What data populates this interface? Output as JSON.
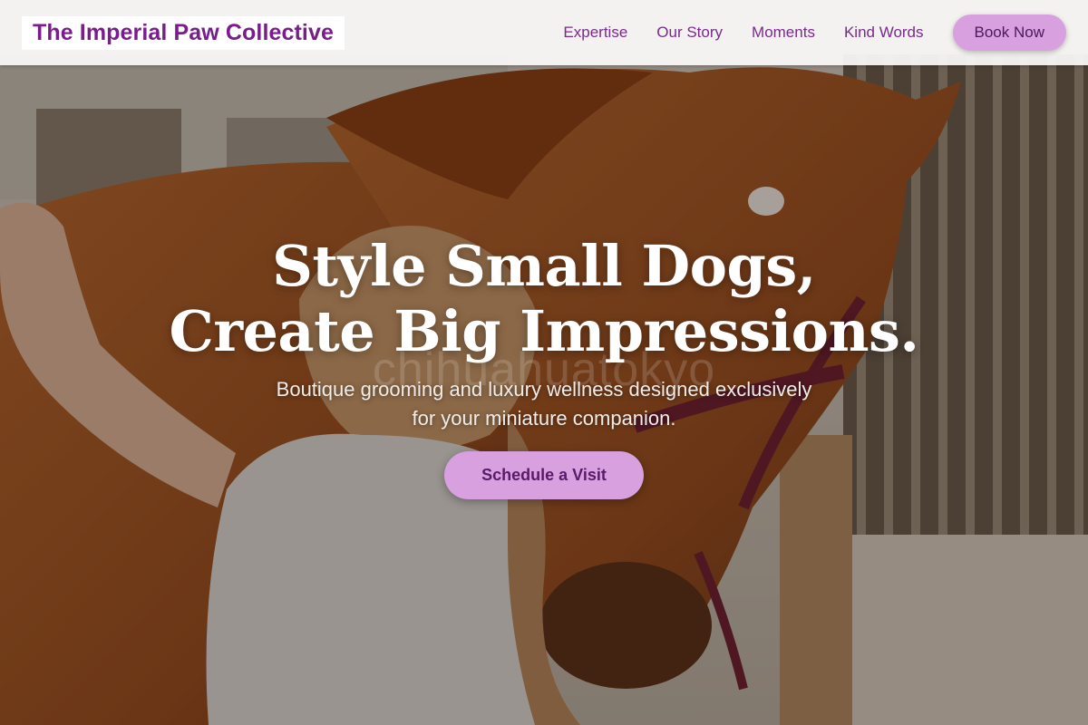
{
  "header": {
    "brand": "The Imperial Paw Collective",
    "nav": [
      "Expertise",
      "Our Story",
      "Moments",
      "Kind Words"
    ],
    "book_label": "Book Now"
  },
  "hero": {
    "headline_line1": "Style Small Dogs,",
    "headline_line2": "Create Big Impressions.",
    "subtitle": "Boutique grooming and luxury wellness designed exclusively for your miniature companion.",
    "cta_label": "Schedule a Visit",
    "watermark": "chihuahuatokyo"
  },
  "colors": {
    "brand_purple": "#7a1d8c",
    "button_lilac": "#d9a0e0",
    "header_bg": "#faf8f8"
  }
}
